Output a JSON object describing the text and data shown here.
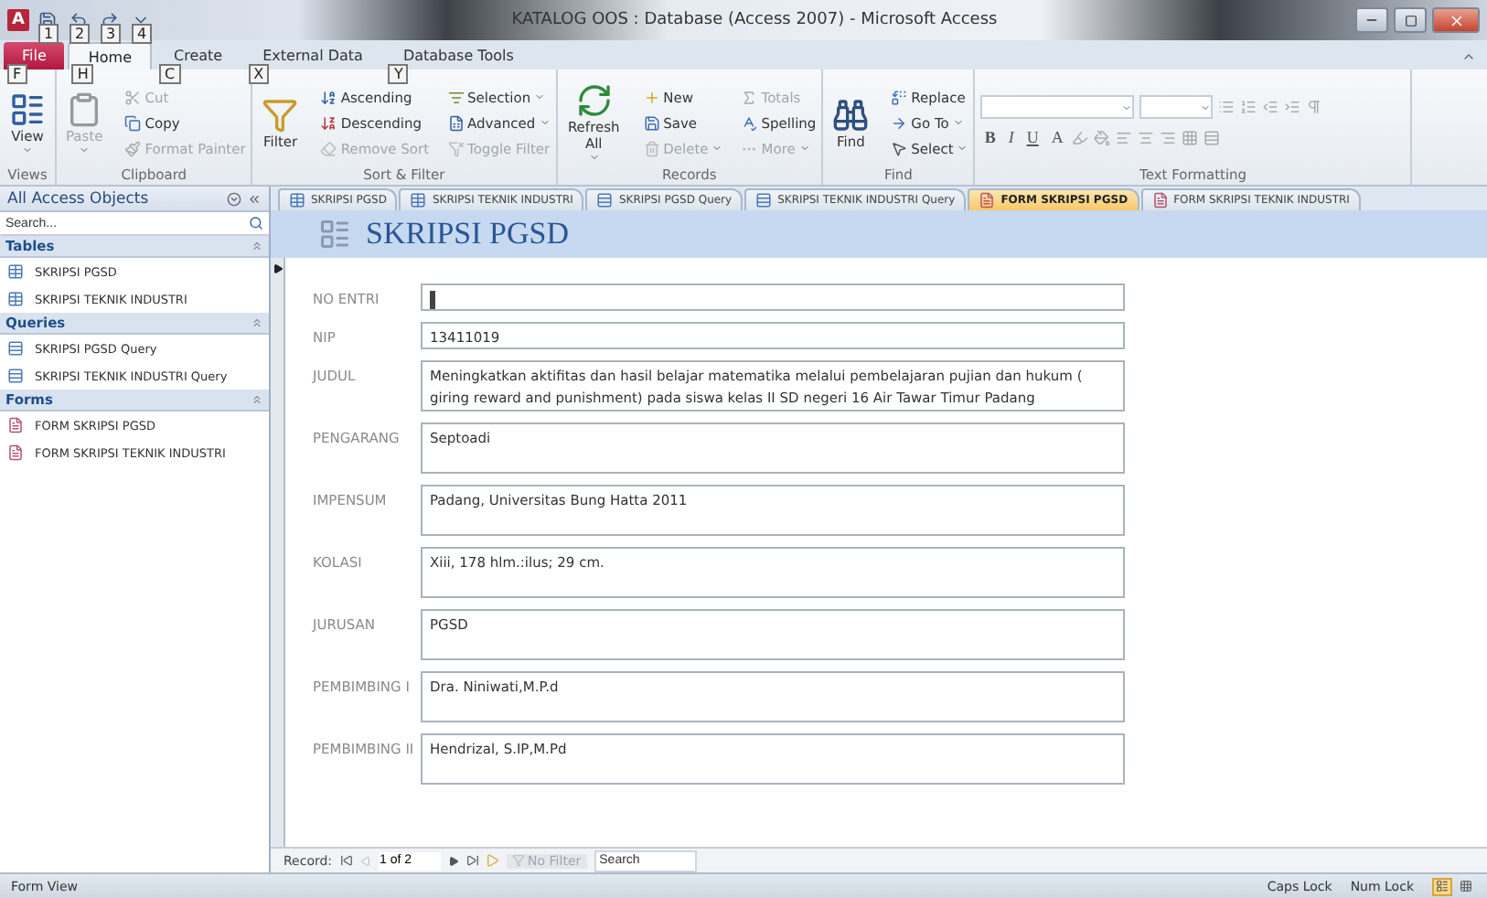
{
  "window": {
    "title": "KATALOG OOS : Database (Access 2007) - Microsoft Access",
    "app_logo": "A",
    "quick_access_keytips": [
      "1",
      "2",
      "3",
      "4"
    ]
  },
  "ribbon_tabs": [
    {
      "label": "File",
      "keytip": "F",
      "selected": false,
      "kind": "file"
    },
    {
      "label": "Home",
      "keytip": "H",
      "selected": true,
      "kind": "tab"
    },
    {
      "label": "Create",
      "keytip": "C",
      "selected": false,
      "kind": "tab"
    },
    {
      "label": "External Data",
      "keytip": "X",
      "selected": false,
      "kind": "tab"
    },
    {
      "label": "Database Tools",
      "keytip": "Y",
      "selected": false,
      "kind": "tab"
    }
  ],
  "ribbon_groups": [
    {
      "label": "Views",
      "items": [
        {
          "label": "View",
          "kind": "large",
          "disabled": false,
          "dropdown": true
        }
      ]
    },
    {
      "label": "Clipboard",
      "items": [
        {
          "label": "Paste",
          "kind": "large",
          "disabled": true,
          "dropdown": true
        },
        {
          "label": "Cut",
          "kind": "small",
          "disabled": true,
          "dropdown": false
        },
        {
          "label": "Copy",
          "kind": "small",
          "disabled": false,
          "dropdown": false
        },
        {
          "label": "Format Painter",
          "kind": "small",
          "disabled": true,
          "dropdown": false
        }
      ]
    },
    {
      "label": "Sort & Filter",
      "items": [
        {
          "label": "Filter",
          "kind": "large",
          "disabled": false,
          "dropdown": false
        },
        {
          "label": "Ascending",
          "kind": "small",
          "disabled": false,
          "dropdown": false
        },
        {
          "label": "Descending",
          "kind": "small",
          "disabled": false,
          "dropdown": false
        },
        {
          "label": "Remove Sort",
          "kind": "small",
          "disabled": true,
          "dropdown": false
        },
        {
          "label": "Selection",
          "kind": "small",
          "disabled": false,
          "dropdown": true
        },
        {
          "label": "Advanced",
          "kind": "small",
          "disabled": false,
          "dropdown": true
        },
        {
          "label": "Toggle Filter",
          "kind": "small",
          "disabled": true,
          "dropdown": false
        }
      ]
    },
    {
      "label": "Records",
      "items": [
        {
          "label": "Refresh All",
          "kind": "large",
          "disabled": false,
          "dropdown": true
        },
        {
          "label": "New",
          "kind": "small",
          "disabled": false,
          "dropdown": false
        },
        {
          "label": "Save",
          "kind": "small",
          "disabled": false,
          "dropdown": false
        },
        {
          "label": "Delete",
          "kind": "small",
          "disabled": true,
          "dropdown": true
        },
        {
          "label": "Totals",
          "kind": "small",
          "disabled": true,
          "dropdown": false
        },
        {
          "label": "Spelling",
          "kind": "small",
          "disabled": false,
          "dropdown": false
        },
        {
          "label": "More",
          "kind": "small",
          "disabled": true,
          "dropdown": true
        }
      ]
    },
    {
      "label": "Find",
      "items": [
        {
          "label": "Find",
          "kind": "large",
          "disabled": false,
          "dropdown": false
        },
        {
          "label": "Replace",
          "kind": "small",
          "disabled": false,
          "dropdown": false
        },
        {
          "label": "Go To",
          "kind": "small",
          "disabled": false,
          "dropdown": true
        },
        {
          "label": "Select",
          "kind": "small",
          "disabled": false,
          "dropdown": true
        }
      ]
    }
  ],
  "text_formatting": {
    "label": "Text Formatting",
    "format_letters": [
      "B",
      "I",
      "U",
      "A"
    ]
  },
  "nav_pane": {
    "title": "All Access Objects",
    "search_placeholder": "Search...",
    "groups": [
      {
        "label": "Tables",
        "kind": "table",
        "items": [
          "SKRIPSI PGSD",
          "SKRIPSI TEKNIK INDUSTRI"
        ]
      },
      {
        "label": "Queries",
        "kind": "query",
        "items": [
          "SKRIPSI PGSD Query",
          "SKRIPSI TEKNIK INDUSTRI Query"
        ]
      },
      {
        "label": "Forms",
        "kind": "form",
        "items": [
          "FORM SKRIPSI PGSD",
          "FORM SKRIPSI TEKNIK INDUSTRI"
        ]
      }
    ]
  },
  "document_tabs": [
    {
      "label": "SKRIPSI PGSD",
      "kind": "table",
      "selected": false
    },
    {
      "label": "SKRIPSI TEKNIK INDUSTRI",
      "kind": "table",
      "selected": false
    },
    {
      "label": "SKRIPSI PGSD Query",
      "kind": "query",
      "selected": false
    },
    {
      "label": "SKRIPSI TEKNIK INDUSTRI Query",
      "kind": "query",
      "selected": false
    },
    {
      "label": "FORM SKRIPSI PGSD",
      "kind": "form",
      "selected": true
    },
    {
      "label": "FORM SKRIPSI TEKNIK INDUSTRI",
      "kind": "form",
      "selected": false
    }
  ],
  "form": {
    "title": "SKRIPSI PGSD",
    "fields": [
      {
        "label": "NO ENTRI",
        "kind": "text",
        "focused": true
      },
      {
        "label": "NIP",
        "value": "13411019",
        "kind": "text",
        "focused": false
      },
      {
        "label": "JUDUL",
        "value": "Meningkatkan aktifitas dan hasil belajar matematika melalui pembelajaran pujian dan hukum ( giring reward and punishment) pada siswa kelas II SD negeri 16 Air Tawar Timur Padang",
        "kind": "memo",
        "focused": false
      },
      {
        "label": "PENGARANG",
        "value": "Septoadi",
        "kind": "memo",
        "focused": false
      },
      {
        "label": "IMPENSUM",
        "value": "Padang, Universitas Bung Hatta 2011",
        "kind": "memo",
        "focused": false
      },
      {
        "label": "KOLASI",
        "value": "Xiii, 178 hlm.:ilus; 29 cm.",
        "kind": "memo",
        "focused": false
      },
      {
        "label": "JURUSAN",
        "value": "PGSD",
        "kind": "memo",
        "focused": false
      },
      {
        "label": "PEMBIMBING I",
        "value": "Dra. Niniwati,M.P.d",
        "kind": "memo",
        "focused": false
      },
      {
        "label": "PEMBIMBING II",
        "value": "Hendrizal, S.IP,M.Pd",
        "kind": "memo",
        "focused": false
      }
    ]
  },
  "record_nav": {
    "label": "Record:",
    "position": "1 of 2",
    "filter": "No Filter",
    "search_placeholder": "Search"
  },
  "status_bar": {
    "left": "Form View",
    "indicators": [
      "Caps Lock",
      "Num Lock"
    ]
  }
}
